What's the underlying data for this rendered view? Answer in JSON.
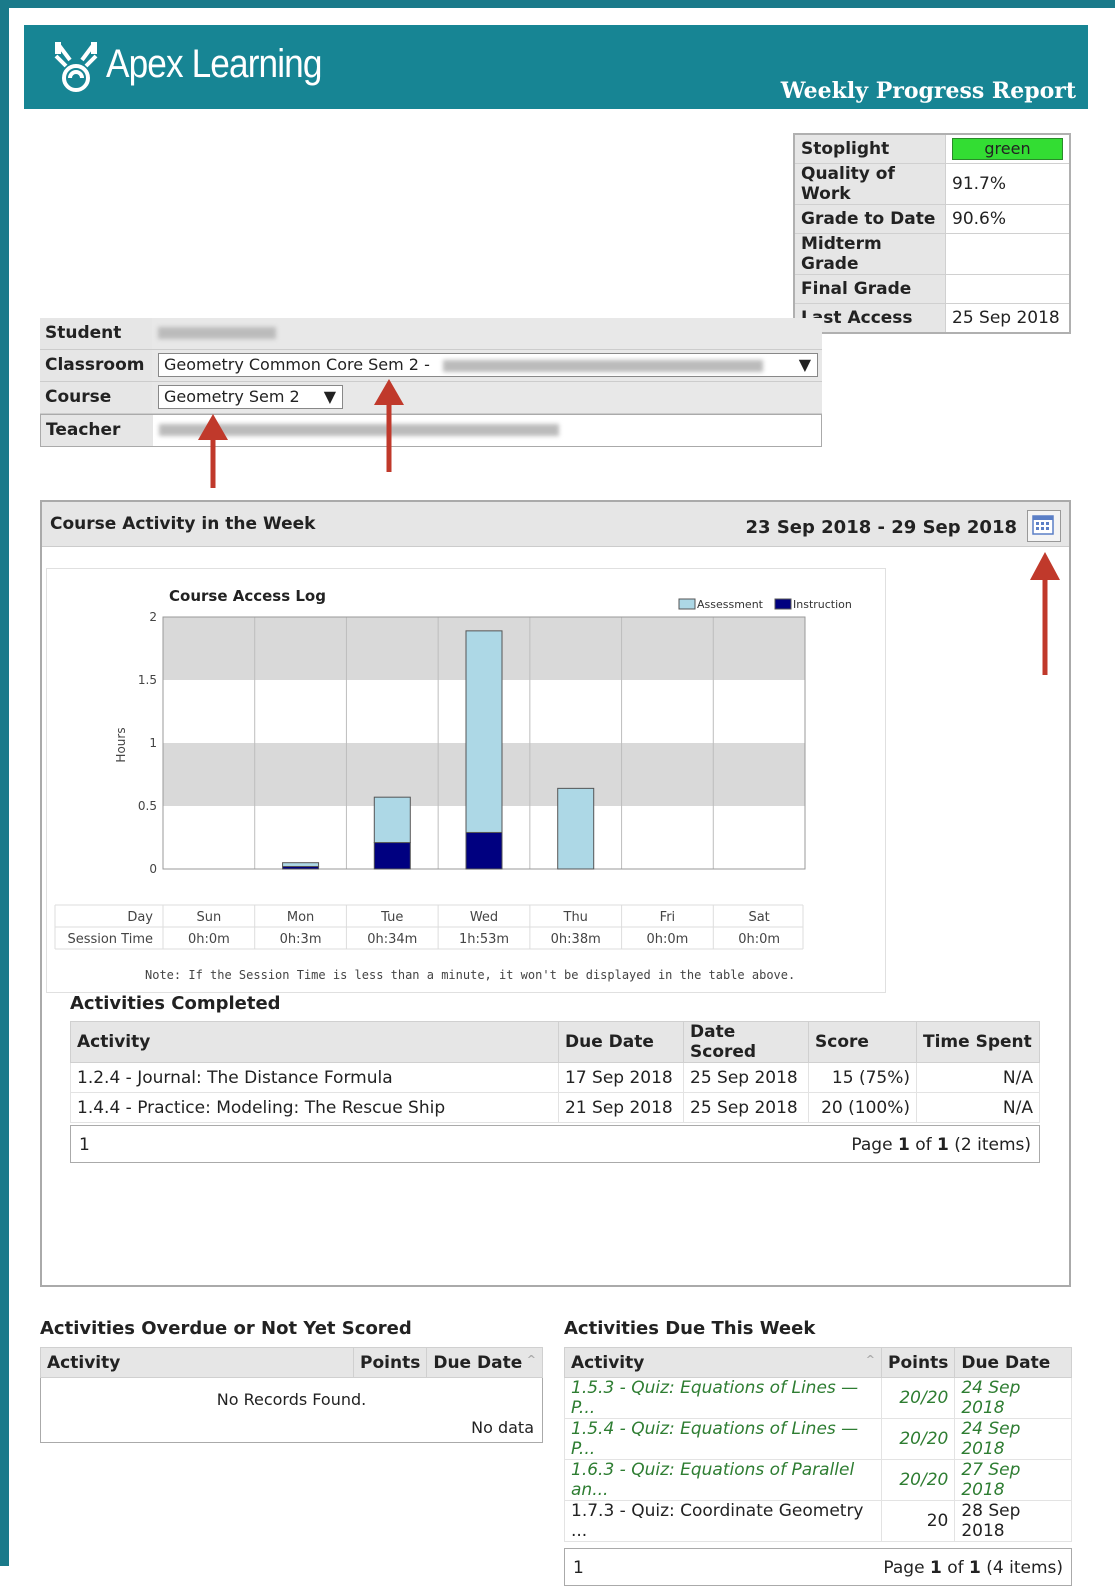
{
  "header": {
    "brand": "Apex Learning",
    "report_title": "Weekly Progress Report"
  },
  "summary": {
    "rows": [
      {
        "label": "Stoplight",
        "value": "green"
      },
      {
        "label": "Quality of Work",
        "value": "91.7%"
      },
      {
        "label": "Grade to Date",
        "value": "90.6%"
      },
      {
        "label": "Midterm Grade",
        "value": ""
      },
      {
        "label": "Final Grade",
        "value": ""
      },
      {
        "label": "Last Access",
        "value": "25 Sep 2018"
      }
    ],
    "stoplight_color": "#33dd33"
  },
  "student": {
    "labels": {
      "student": "Student",
      "classroom": "Classroom",
      "course": "Course",
      "teacher": "Teacher"
    },
    "classroom_value": "Geometry Common Core Sem 2 -",
    "course_value": "Geometry Sem 2"
  },
  "activity": {
    "title": "Course Activity in the Week",
    "date_range": "23 Sep 2018 - 29 Sep 2018"
  },
  "chart_data": {
    "type": "bar",
    "title": "Course Access Log",
    "ylabel": "Hours",
    "xlabel": "",
    "categories": [
      "Sun",
      "Mon",
      "Tue",
      "Wed",
      "Thu",
      "Fri",
      "Sat"
    ],
    "series": [
      {
        "name": "Instruction",
        "color": "#000080",
        "values": [
          0,
          0.02,
          0.21,
          0.29,
          0,
          0,
          0
        ]
      },
      {
        "name": "Assessment",
        "color": "#add8e6",
        "values": [
          0,
          0.03,
          0.36,
          1.6,
          0.64,
          0,
          0
        ]
      }
    ],
    "stacked": true,
    "ylim": [
      0,
      2
    ],
    "yticks": [
      "0",
      "0.5",
      "1",
      "1.5",
      "2"
    ],
    "legend_position": "top-right",
    "session_table": {
      "day_label": "Day",
      "time_label": "Session Time",
      "days": [
        "Sun",
        "Mon",
        "Tue",
        "Wed",
        "Thu",
        "Fri",
        "Sat"
      ],
      "times": [
        "0h:0m",
        "0h:3m",
        "0h:34m",
        "1h:53m",
        "0h:38m",
        "0h:0m",
        "0h:0m"
      ]
    },
    "note": "Note: If the Session Time is less than a minute, it won't be displayed in the table above."
  },
  "completed": {
    "title": "Activities Completed",
    "headers": [
      "Activity",
      "Due Date",
      "Date Scored",
      "Score",
      "Time Spent"
    ],
    "rows": [
      [
        "1.2.4 - Journal: The Distance Formula",
        "17 Sep 2018",
        "25 Sep 2018",
        "15 (75%)",
        "N/A"
      ],
      [
        "1.4.4 - Practice: Modeling: The Rescue Ship",
        "21 Sep 2018",
        "25 Sep 2018",
        "20 (100%)",
        "N/A"
      ]
    ],
    "pager_page": "1",
    "pager_text_a": "Page ",
    "pager_cur": "1",
    "pager_of": " of ",
    "pager_total": "1",
    "pager_items": " (2 items)"
  },
  "overdue": {
    "title": "Activities Overdue or Not Yet Scored",
    "headers": [
      "Activity",
      "Points",
      "Due Date"
    ],
    "empty": "No Records Found.",
    "no_data": "No data"
  },
  "due_week": {
    "title": "Activities Due This Week",
    "headers": [
      "Activity",
      "Points",
      "Due Date"
    ],
    "rows": [
      [
        "1.5.3 - Quiz: Equations of Lines — P...",
        "20/20",
        "24 Sep 2018"
      ],
      [
        "1.5.4 - Quiz: Equations of Lines — P...",
        "20/20",
        "24 Sep 2018"
      ],
      [
        "1.6.3 - Quiz: Equations of Parallel an...",
        "20/20",
        "27 Sep 2018"
      ],
      [
        "1.7.3 - Quiz: Coordinate Geometry ...",
        "20",
        "28 Sep 2018"
      ]
    ],
    "pager_page": "1",
    "pager_text_a": "Page ",
    "pager_cur": "1",
    "pager_of": " of ",
    "pager_total": "1",
    "pager_items": " (4 items)"
  }
}
